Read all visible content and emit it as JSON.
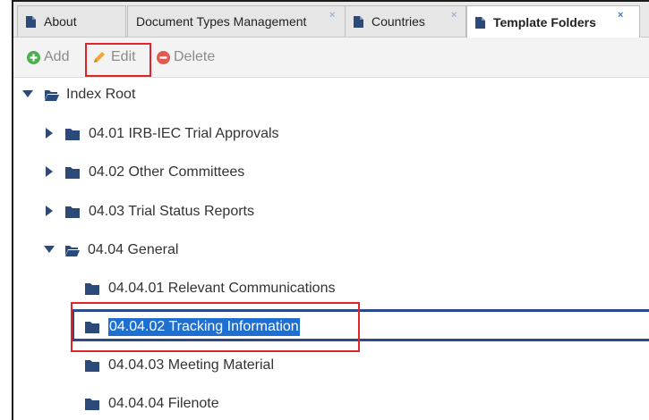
{
  "tabs": [
    {
      "label": "About",
      "closable": false
    },
    {
      "label": "Document Types Management",
      "closable": true
    },
    {
      "label": "Countries",
      "closable": true
    },
    {
      "label": "Template Folders",
      "closable": true,
      "active": true
    }
  ],
  "close_glyph": "×",
  "toolbar": {
    "add_label": "Add",
    "edit_label": "Edit",
    "delete_label": "Delete"
  },
  "tree": {
    "root": {
      "label": "Index Root",
      "expanded": true
    },
    "items": [
      {
        "label": "04.01 IRB-IEC Trial Approvals",
        "expanded": false
      },
      {
        "label": "04.02 Other Committees",
        "expanded": false
      },
      {
        "label": "04.03 Trial Status Reports",
        "expanded": false
      },
      {
        "label": "04.04 General",
        "expanded": true,
        "children": [
          {
            "label": "04.04.01 Relevant Communications"
          },
          {
            "label": "04.04.02 Tracking Information",
            "selected": true
          },
          {
            "label": "04.04.03 Meeting Material"
          },
          {
            "label": "04.04.04 Filenote"
          }
        ]
      }
    ]
  },
  "colors": {
    "folder": "#2b4a7a",
    "selection": "#1f6fd1",
    "highlight": "#e0242a",
    "add_icon": "#4caf50",
    "edit_icon": "#f0a830",
    "delete_icon": "#e05a4f"
  },
  "icons": [
    "doc-icon",
    "close-icon",
    "add-icon",
    "pencil-icon",
    "delete-icon",
    "caret-down-icon",
    "caret-right-icon",
    "folder-open-icon",
    "folder-icon"
  ]
}
